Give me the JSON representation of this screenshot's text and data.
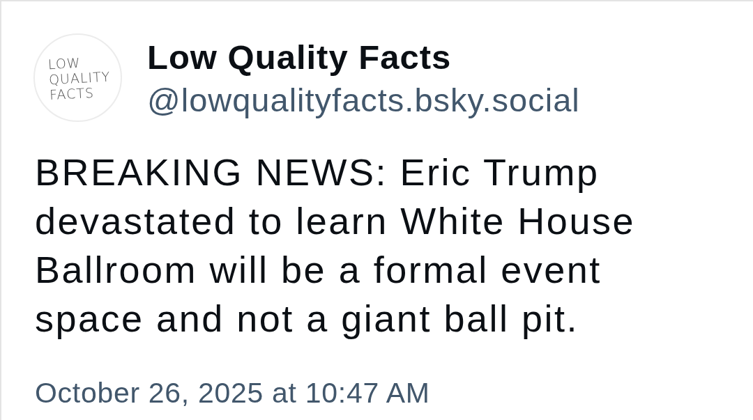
{
  "post": {
    "avatar": {
      "logo_lines": [
        "LOW",
        "QUALITY",
        "FACTS"
      ]
    },
    "author": {
      "display_name": "Low Quality Facts",
      "handle": "@lowqualityfacts.bsky.social"
    },
    "text": "BREAKING NEWS: Eric Trump devastated to learn White House Ballroom will be a formal event space and not a giant ball pit.",
    "timestamp": "October 26, 2025 at 10:47 AM"
  }
}
